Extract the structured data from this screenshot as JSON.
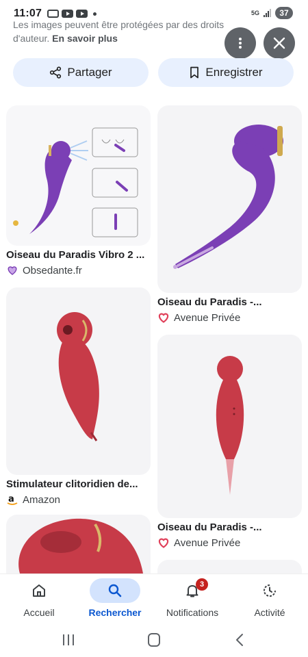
{
  "status_bar": {
    "time": "11:07",
    "network": "5G",
    "battery": "37"
  },
  "notice": {
    "text": "Les images peuvent être protégées par des droits d'auteur.",
    "link": "En savoir plus"
  },
  "actions": {
    "share_label": "Partager",
    "save_label": "Enregistrer"
  },
  "results": [
    {
      "title": "Oiseau du Paradis Vibro 2 ...",
      "source": "Obsedante.fr",
      "source_icon": "heart-outline-icon",
      "color": "#7b3fb5"
    },
    {
      "title": "Oiseau du Paradis -...",
      "source": "Avenue Privée",
      "source_icon": "heart-icon",
      "color": "#7b3fb5"
    },
    {
      "title": "Stimulateur clitoridien de...",
      "source": "Amazon",
      "source_icon": "amazon-icon",
      "color": "#c73b48"
    },
    {
      "title": "Oiseau du Paradis -...",
      "source": "Avenue Privée",
      "source_icon": "heart-icon",
      "color": "#c73b48"
    }
  ],
  "bottom_nav": {
    "items": [
      {
        "label": "Accueil",
        "icon": "home-icon"
      },
      {
        "label": "Rechercher",
        "icon": "search-icon",
        "active": true
      },
      {
        "label": "Notifications",
        "icon": "bell-icon",
        "badge": "3"
      },
      {
        "label": "Activité",
        "icon": "activity-icon"
      }
    ]
  },
  "colors": {
    "accent": "#0b57d0",
    "pill_bg": "#e8f0fe",
    "active_nav_bg": "#d3e3fd",
    "badge": "#c5221f",
    "avenue_privee": "#e0405a"
  }
}
